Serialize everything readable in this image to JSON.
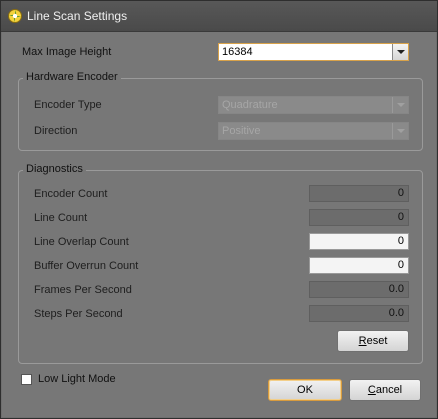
{
  "window": {
    "title": "Line Scan Settings"
  },
  "max_image_height": {
    "label": "Max Image Height",
    "value": "16384"
  },
  "hardware_encoder": {
    "title": "Hardware Encoder",
    "encoder_type": {
      "label": "Encoder Type",
      "value": "Quadrature"
    },
    "direction": {
      "label": "Direction",
      "value": "Positive"
    }
  },
  "diagnostics": {
    "title": "Diagnostics",
    "rows": [
      {
        "label": "Encoder Count",
        "value": "0"
      },
      {
        "label": "Line Count",
        "value": "0"
      },
      {
        "label": "Line Overlap Count",
        "value": "0"
      },
      {
        "label": "Buffer Overrun Count",
        "value": "0"
      },
      {
        "label": "Frames Per Second",
        "value": "0.0"
      },
      {
        "label": "Steps Per Second",
        "value": "0.0"
      }
    ],
    "reset": {
      "pre": "",
      "key": "R",
      "post": "eset"
    }
  },
  "low_light_mode": {
    "label": "Low Light Mode",
    "checked": false
  },
  "buttons": {
    "ok": "OK",
    "cancel": {
      "key": "C",
      "post": "ancel"
    }
  },
  "colors": {
    "accent_border": "#d89b3e",
    "title_bar": "#4f4f4f",
    "client_bg": "#777777"
  }
}
